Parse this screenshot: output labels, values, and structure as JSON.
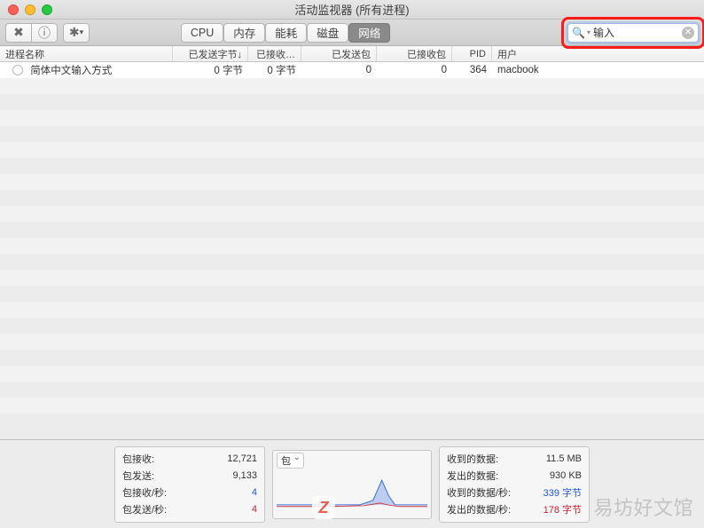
{
  "window": {
    "title": "活动监视器 (所有进程)"
  },
  "toolbar": {
    "stop_icon": "⊘",
    "info_icon": "ⓘ",
    "gear_icon": "✻",
    "tabs": {
      "cpu": "CPU",
      "memory": "内存",
      "energy": "能耗",
      "disk": "磁盘",
      "network": "网络"
    },
    "active_tab": "network"
  },
  "search": {
    "value": "输入",
    "magnifier": "🔍"
  },
  "columns": {
    "name": "进程名称",
    "sent_bytes": "已发送字节↓",
    "recv_bytes": "已接收…",
    "sent_pkts": "已发送包",
    "recv_pkts": "已接收包",
    "pid": "PID",
    "user": "用户"
  },
  "rows": [
    {
      "name": "简体中文输入方式",
      "sent_bytes": "0 字节",
      "recv_bytes": "0 字节",
      "sent_pkts": "0",
      "recv_pkts": "0",
      "pid": "364",
      "user": "macbook"
    }
  ],
  "stats_left": {
    "pkt_in_label": "包接收:",
    "pkt_in": "12,721",
    "pkt_out_label": "包发送:",
    "pkt_out": "9,133",
    "pkt_in_rate_label": "包接收/秒:",
    "pkt_in_rate": "4",
    "pkt_out_rate_label": "包发送/秒:",
    "pkt_out_rate": "4"
  },
  "chart": {
    "selector": "包"
  },
  "stats_right": {
    "data_in_label": "收到的数据:",
    "data_in": "11.5 MB",
    "data_out_label": "发出的数据:",
    "data_out": "930 KB",
    "data_in_rate_label": "收到的数据/秒:",
    "data_in_rate": "339 字节",
    "data_out_rate_label": "发出的数据/秒:",
    "data_out_rate": "178 字节"
  },
  "watermarks": {
    "right": "易坊好文馆",
    "z": "Z"
  }
}
